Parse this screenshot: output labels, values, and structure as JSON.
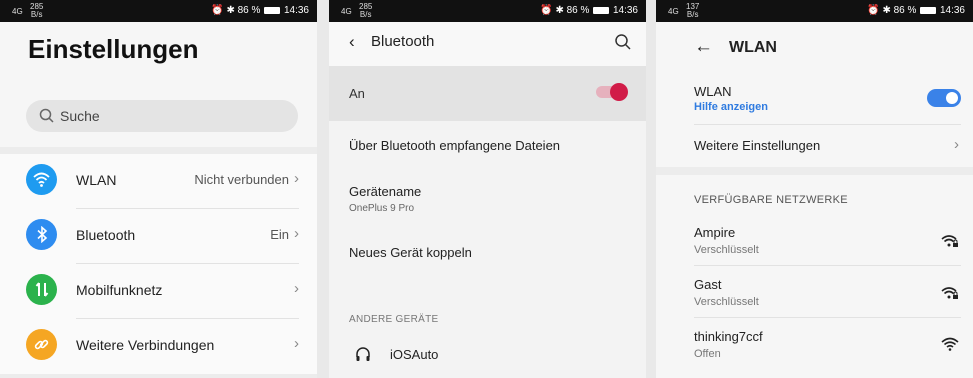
{
  "status": [
    {
      "signal": "4G",
      "speed": "285",
      "unit": "B/s",
      "battery": "86 %",
      "time": "14:36",
      "alarm": "⏰",
      "bt": "✱"
    },
    {
      "signal": "4G",
      "speed": "285",
      "unit": "B/s",
      "battery": "86 %",
      "time": "14:36",
      "alarm": "⏰",
      "bt": "✱"
    },
    {
      "signal": "4G",
      "speed": "137",
      "unit": "B/s",
      "battery": "86 %",
      "time": "14:36",
      "alarm": "⏰",
      "bt": "✱"
    }
  ],
  "settings": {
    "title": "Einstellungen",
    "search_placeholder": "Suche",
    "items": [
      {
        "label": "WLAN",
        "value": "Nicht verbunden",
        "icon": "wifi-icon",
        "color": "#1e9bf0"
      },
      {
        "label": "Bluetooth",
        "value": "Ein",
        "icon": "bluetooth-icon",
        "color": "#2e8cf0"
      },
      {
        "label": "Mobilfunknetz",
        "value": "",
        "icon": "mobile-data-icon",
        "color": "#2bb24c"
      },
      {
        "label": "Weitere Verbindungen",
        "value": "",
        "icon": "link-icon",
        "color": "#f5a623"
      }
    ]
  },
  "bluetooth": {
    "title": "Bluetooth",
    "toggle_label": "An",
    "toggle_on": true,
    "received_files": "Über Bluetooth empfangene Dateien",
    "device_name_label": "Gerätename",
    "device_name_value": "OnePlus 9 Pro",
    "pair_new": "Neues Gerät koppeln",
    "other_devices_header": "ANDERE GERÄTE",
    "devices": [
      {
        "name": "iOSAuto",
        "icon": "headphones-icon"
      }
    ]
  },
  "wlan": {
    "title": "WLAN",
    "toggle_label": "WLAN",
    "help_link": "Hilfe anzeigen",
    "toggle_on": true,
    "more_settings": "Weitere Einstellungen",
    "networks_header": "VERFÜGBARE NETZWERKE",
    "networks": [
      {
        "name": "Ampire",
        "status": "Verschlüsselt",
        "locked": true
      },
      {
        "name": "Gast",
        "status": "Verschlüsselt",
        "locked": true
      },
      {
        "name": "thinking7ccf",
        "status": "Offen",
        "locked": false
      }
    ]
  }
}
